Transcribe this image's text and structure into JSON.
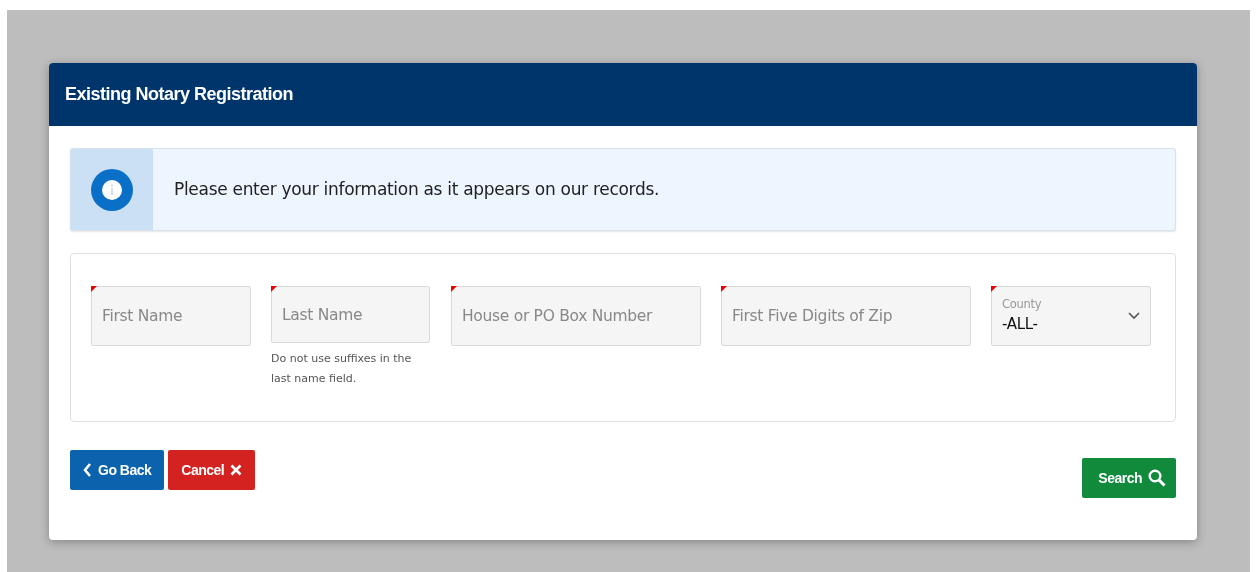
{
  "card": {
    "title": "Existing Notary Registration"
  },
  "info": {
    "message": "Please enter your information as it appears on our records."
  },
  "fields": [
    {
      "kind": "input",
      "placeholder": "First Name",
      "required": true
    },
    {
      "kind": "input",
      "placeholder": "Last Name",
      "required": true,
      "help": "Do not use suffixes in the last name field."
    },
    {
      "kind": "input",
      "placeholder": "House or PO Box Number",
      "required": true
    },
    {
      "kind": "input",
      "placeholder": "First Five Digits of Zip",
      "required": true
    },
    {
      "kind": "select",
      "label": "County",
      "value": "-ALL-",
      "required": true
    }
  ],
  "buttons": [
    {
      "kind": "back",
      "label": "Go Back"
    },
    {
      "kind": "cancel",
      "label": "Cancel"
    },
    {
      "kind": "search",
      "label": "Search"
    }
  ]
}
